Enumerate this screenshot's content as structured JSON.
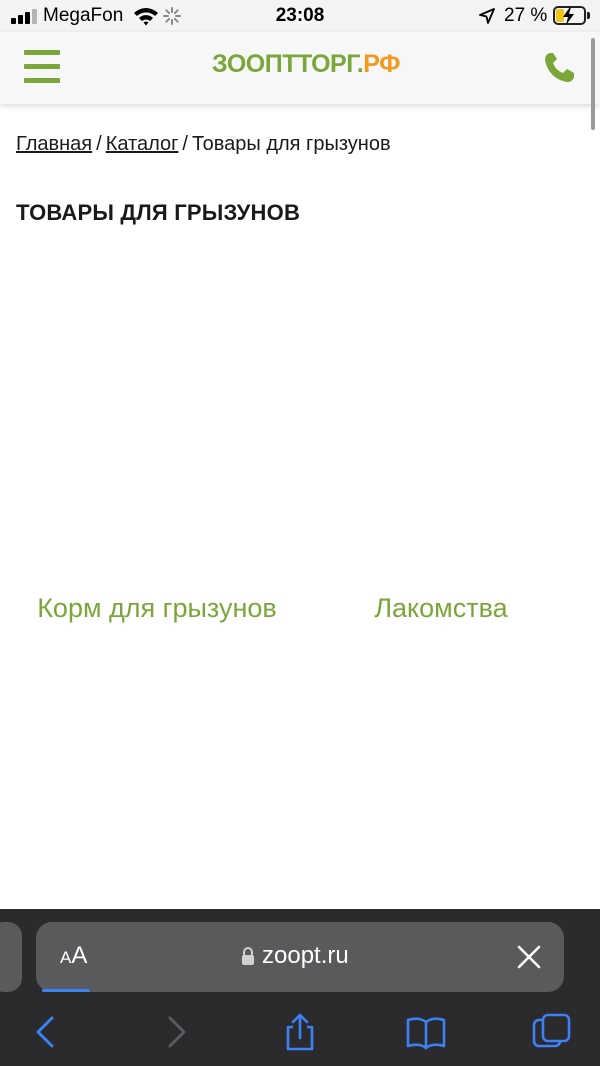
{
  "status_bar": {
    "carrier": "MegaFon",
    "time": "23:08",
    "battery_percent": "27 %",
    "battery_level": 0.27
  },
  "header": {
    "logo_main": "ЗООПТТОРГ.",
    "logo_tld": "РФ",
    "accent_color": "#7aa63a",
    "logo_tld_color": "#f29a1f"
  },
  "breadcrumb": {
    "home": "Главная",
    "separator": "/",
    "catalog": "Каталог",
    "current": "Товары для грызунов"
  },
  "page": {
    "title": "ТОВАРЫ ДЛЯ ГРЫЗУНОВ",
    "categories": [
      {
        "label": "Корм для грызунов"
      },
      {
        "label": "Лакомства"
      }
    ]
  },
  "safari": {
    "aa_small": "A",
    "aa_large": "A",
    "url": "zoopt.ru",
    "icons": [
      "back-icon",
      "forward-icon",
      "share-icon",
      "bookmarks-icon",
      "tabs-icon"
    ],
    "bar_color": "#2b2b2d",
    "active_color": "#3b82f6"
  }
}
